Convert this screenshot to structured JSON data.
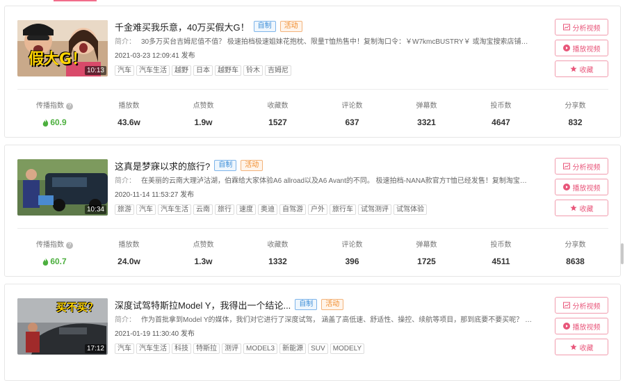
{
  "colors": {
    "accent": "#e8567a",
    "green": "#4caf3e",
    "badge_blue": "#3f8fd8",
    "badge_orange": "#f08a28"
  },
  "labels": {
    "intro_prefix": "简介：",
    "publish_suffix": "发布",
    "analyze_button": "分析视频",
    "play_button": "播放视频",
    "collect_button": "收藏",
    "badge_own": "自制",
    "badge_activity": "活动"
  },
  "stat_labels": [
    "传播指数",
    "播放数",
    "点赞数",
    "收藏数",
    "评论数",
    "弹幕数",
    "投币数",
    "分享数"
  ],
  "videos": [
    {
      "title": "千金难买我乐意，40万买假大G！",
      "duration": "10:13",
      "intro": "30多万买台吉姆尼值不值？ 极速拍档极速姐妹花抱枕、限量T恤热售中！复制淘口令：￥W7kmcBUSTRY￥ 或淘宝搜索店铺：极速...",
      "date": "2021-03-23 12:09:41",
      "thumb_text": "假大G！",
      "tags": [
        "汽车",
        "汽车生活",
        "越野",
        "日本",
        "越野车",
        "铃木",
        "吉姆尼"
      ],
      "stats": [
        "60.9",
        "43.6w",
        "1.9w",
        "1527",
        "637",
        "3321",
        "4647",
        "832"
      ]
    },
    {
      "title": "这真是梦寐以求的旅行?",
      "duration": "10:34",
      "intro": "在美丽的云南大理泸沽湖，伯霖给大家体验A6 allroad以及A6 Avant的不同。 极速拍档-NANA款官方T恤已经发售！复制淘宝口令 ...",
      "date": "2020-11-14 11:53:27",
      "thumb_text": "",
      "tags": [
        "旅游",
        "汽车",
        "汽车生活",
        "云南",
        "旅行",
        "速度",
        "奥迪",
        "自驾游",
        "户外",
        "旅行车",
        "试驾测评",
        "试驾体验"
      ],
      "stats": [
        "60.7",
        "24.0w",
        "1.3w",
        "1332",
        "396",
        "1725",
        "4511",
        "8638"
      ]
    },
    {
      "title": "深度试驾特斯拉Model Y，我得出一个结论...",
      "duration": "17:12",
      "intro": "作为首批拿到Model Y的媒体，我们对它进行了深度试驾， 涵盖了高低速、舒适性、操控、续航等项目，那到底要不要买呢？ 极速...",
      "date": "2021-01-19 11:30:40",
      "thumb_text": "买不买？",
      "tags": [
        "汽车",
        "汽车生活",
        "科技",
        "特斯拉",
        "测评",
        "MODEL3",
        "新能源",
        "SUV",
        "MODELY"
      ],
      "stats": []
    }
  ]
}
